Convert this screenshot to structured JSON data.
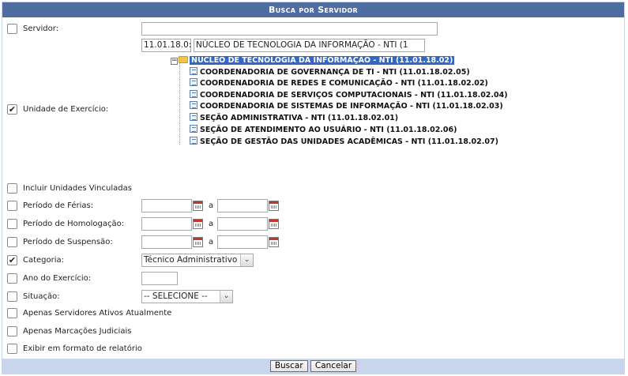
{
  "form": {
    "caption": "Busca por Servidor",
    "servidor": {
      "label": "Servidor:",
      "value": ""
    },
    "unidade": {
      "label": "Unidade de Exercício:",
      "checked": "✔",
      "code_value": "11.01.18.0:",
      "name_value": "NÚCLEO DE TECNOLOGIA DA INFORMAÇÃO - NTI (1",
      "tree": {
        "root": "NÚCLEO DE TECNOLOGIA DA INFORMAÇÃO - NTI (11.01.18.02)",
        "children": [
          "COORDENADORIA DE GOVERNANÇA DE TI - NTI (11.01.18.02.05)",
          "COORDENADORIA DE REDES E COMUNICAÇÃO - NTI (11.01.18.02.02)",
          "COORDENADORIA DE SERVIÇOS COMPUTACIONAIS - NTI (11.01.18.02.04)",
          "COORDENADORIA DE SISTEMAS DE INFORMAÇÃO - NTI (11.01.18.02.03)",
          "SEÇÃO ADMINISTRATIVA - NTI (11.01.18.02.01)",
          "SEÇÃO DE ATENDIMENTO AO USUÁRIO - NTI (11.01.18.02.06)",
          "SEÇÃO DE GESTÃO DAS UNIDADES ACADÊMICAS - NTI (11.01.18.02.07)"
        ]
      }
    },
    "incluir_vinculadas": {
      "label": "Incluir Unidades Vinculadas"
    },
    "ferias": {
      "label": "Período de Férias:",
      "sep": "a"
    },
    "homologacao": {
      "label": "Período de Homologação:",
      "sep": "a"
    },
    "suspensao": {
      "label": "Período de Suspensão:",
      "sep": "a"
    },
    "categoria": {
      "label": "Categoria:",
      "checked": "✔",
      "value": "Técnico Administrativo"
    },
    "ano": {
      "label": "Ano do Exercício:",
      "value": ""
    },
    "situacao": {
      "label": "Situação:",
      "value": "-- SELECIONE --"
    },
    "ativos": {
      "label": "Apenas Servidores Ativos Atualmente"
    },
    "judiciais": {
      "label": "Apenas Marcações Judiciais"
    },
    "relatorio": {
      "label": "Exibir em formato de relatório"
    },
    "buttons": {
      "buscar": "Buscar",
      "cancelar": "Cancelar"
    }
  },
  "colors": {
    "caption_bg": "#4f6da1",
    "footer_bg": "#c8d5ec",
    "tree_selected": "#3468c0"
  }
}
